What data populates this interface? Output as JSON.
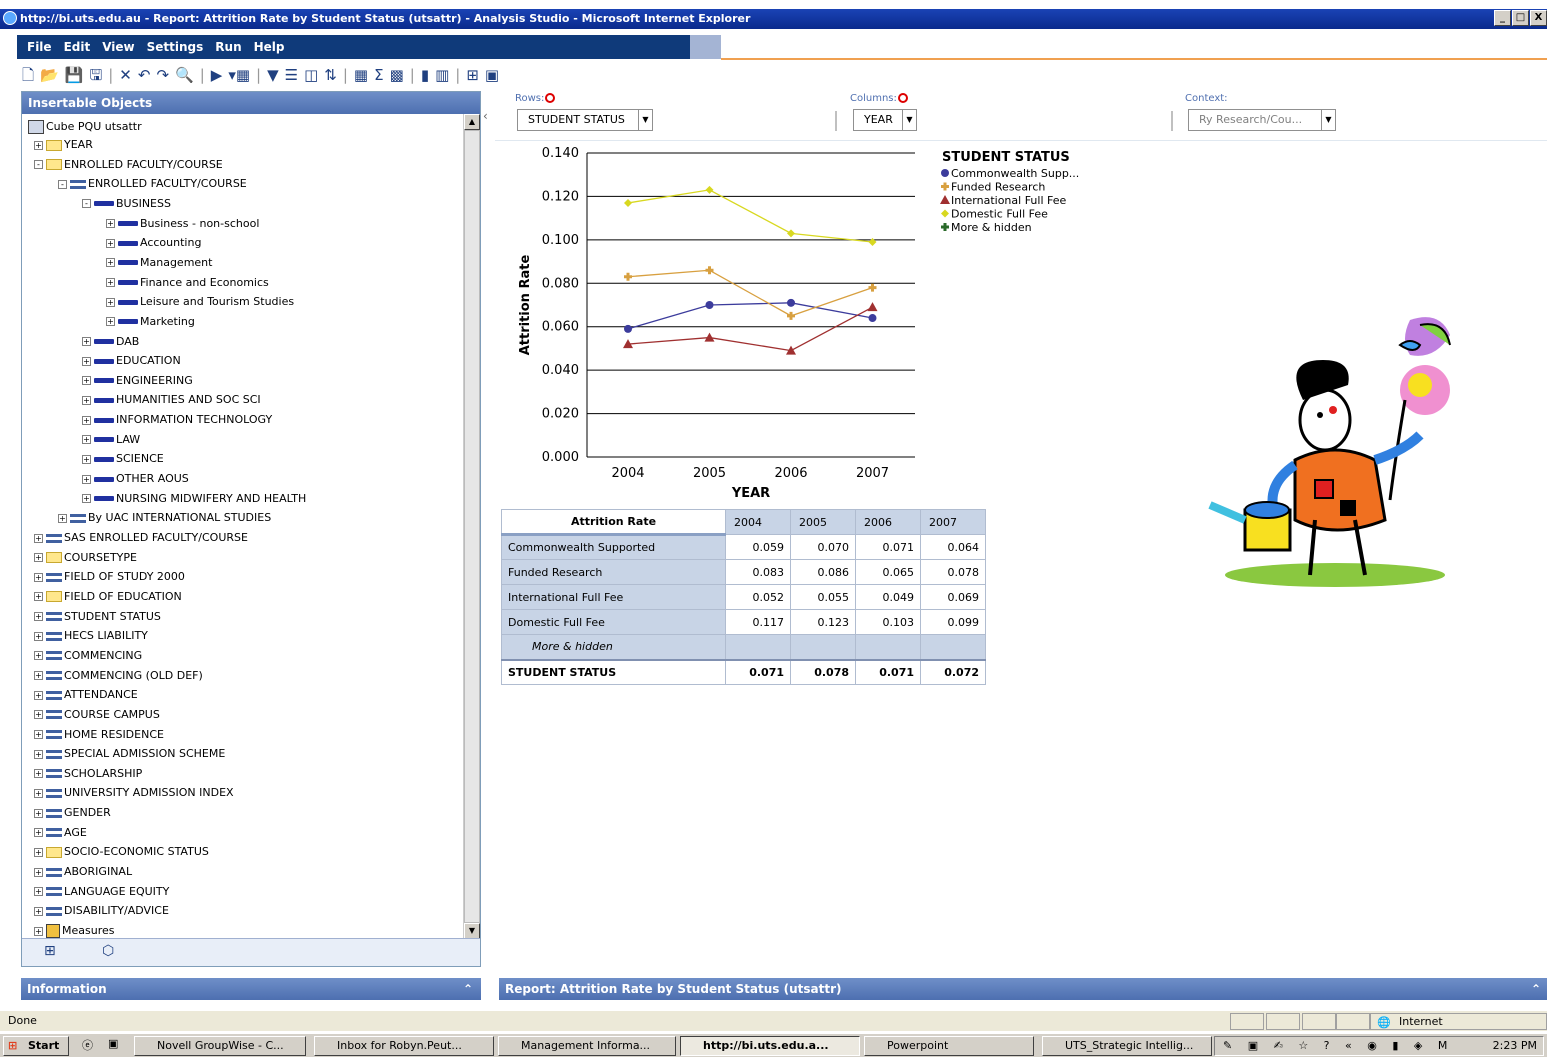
{
  "window": {
    "title": "http://bi.uts.edu.au - Report: Attrition Rate by Student Status (utsattr) - Analysis Studio - Microsoft Internet Explorer",
    "minimize": "_",
    "maximize": "□",
    "close": "X"
  },
  "menu": [
    "File",
    "Edit",
    "View",
    "Settings",
    "Run",
    "Help"
  ],
  "toolbar_icons": [
    "new-icon",
    "open-icon",
    "save-icon",
    "save-as-icon",
    "delete-icon",
    "undo-icon",
    "redo-icon",
    "find-icon",
    "run-icon",
    "group-icon",
    "filter-icon",
    "suppress-icon",
    "top-bottom-icon",
    "sort-icon",
    "calculate-icon",
    "sum-icon",
    "excel-icon",
    "chart-icon",
    "display-icon",
    "insert-icon",
    "properties-icon"
  ],
  "insertable_objects": {
    "title": "Insertable Objects",
    "cube": "Cube PQU utsattr",
    "nodes": [
      {
        "label": "YEAR",
        "icon": "folder",
        "level": 0,
        "exp": "+"
      },
      {
        "label": "ENROLLED FACULTY/COURSE",
        "icon": "folder",
        "level": 0,
        "exp": "-"
      },
      {
        "label": "ENROLLED FACULTY/COURSE",
        "icon": "dim",
        "level": 1,
        "exp": "-"
      },
      {
        "label": "BUSINESS",
        "icon": "bar",
        "level": 2,
        "exp": "-"
      },
      {
        "label": "Business - non-school",
        "icon": "bar",
        "level": 3,
        "exp": "+"
      },
      {
        "label": "Accounting",
        "icon": "bar",
        "level": 3,
        "exp": "+"
      },
      {
        "label": "Management",
        "icon": "bar",
        "level": 3,
        "exp": "+"
      },
      {
        "label": "Finance and Economics",
        "icon": "bar",
        "level": 3,
        "exp": "+"
      },
      {
        "label": "Leisure and Tourism Studies",
        "icon": "bar",
        "level": 3,
        "exp": "+"
      },
      {
        "label": "Marketing",
        "icon": "bar",
        "level": 3,
        "exp": "+"
      },
      {
        "label": "DAB",
        "icon": "bar",
        "level": 2,
        "exp": "+"
      },
      {
        "label": "EDUCATION",
        "icon": "bar",
        "level": 2,
        "exp": "+"
      },
      {
        "label": "ENGINEERING",
        "icon": "bar",
        "level": 2,
        "exp": "+"
      },
      {
        "label": "HUMANITIES AND SOC SCI",
        "icon": "bar",
        "level": 2,
        "exp": "+"
      },
      {
        "label": "INFORMATION TECHNOLOGY",
        "icon": "bar",
        "level": 2,
        "exp": "+"
      },
      {
        "label": "LAW",
        "icon": "bar",
        "level": 2,
        "exp": "+"
      },
      {
        "label": "SCIENCE",
        "icon": "bar",
        "level": 2,
        "exp": "+"
      },
      {
        "label": "OTHER AOUS",
        "icon": "bar",
        "level": 2,
        "exp": "+"
      },
      {
        "label": "NURSING MIDWIFERY AND HEALTH",
        "icon": "bar",
        "level": 2,
        "exp": "+"
      },
      {
        "label": "By UAC INTERNATIONAL STUDIES",
        "icon": "dim",
        "level": 1,
        "exp": "+"
      },
      {
        "label": "SAS ENROLLED FACULTY/COURSE",
        "icon": "dim",
        "level": 0,
        "exp": "+"
      },
      {
        "label": "COURSETYPE",
        "icon": "folder",
        "level": 0,
        "exp": "+"
      },
      {
        "label": "FIELD OF STUDY 2000",
        "icon": "dim",
        "level": 0,
        "exp": "+"
      },
      {
        "label": "FIELD OF EDUCATION",
        "icon": "folder",
        "level": 0,
        "exp": "+"
      },
      {
        "label": "STUDENT STATUS",
        "icon": "dim",
        "level": 0,
        "exp": "+"
      },
      {
        "label": "HECS LIABILITY",
        "icon": "dim",
        "level": 0,
        "exp": "+"
      },
      {
        "label": "COMMENCING",
        "icon": "dim",
        "level": 0,
        "exp": "+"
      },
      {
        "label": "COMMENCING (OLD DEF)",
        "icon": "dim",
        "level": 0,
        "exp": "+"
      },
      {
        "label": "ATTENDANCE",
        "icon": "dim",
        "level": 0,
        "exp": "+"
      },
      {
        "label": "COURSE CAMPUS",
        "icon": "dim",
        "level": 0,
        "exp": "+"
      },
      {
        "label": "HOME RESIDENCE",
        "icon": "dim",
        "level": 0,
        "exp": "+"
      },
      {
        "label": "SPECIAL ADMISSION SCHEME",
        "icon": "dim",
        "level": 0,
        "exp": "+"
      },
      {
        "label": "SCHOLARSHIP",
        "icon": "dim",
        "level": 0,
        "exp": "+"
      },
      {
        "label": "UNIVERSITY ADMISSION INDEX",
        "icon": "dim",
        "level": 0,
        "exp": "+"
      },
      {
        "label": "GENDER",
        "icon": "dim",
        "level": 0,
        "exp": "+"
      },
      {
        "label": "AGE",
        "icon": "dim",
        "level": 0,
        "exp": "+"
      },
      {
        "label": "SOCIO-ECONOMIC STATUS",
        "icon": "folder",
        "level": 0,
        "exp": "+"
      },
      {
        "label": "ABORIGINAL",
        "icon": "dim",
        "level": 0,
        "exp": "+"
      },
      {
        "label": "LANGUAGE EQUITY",
        "icon": "dim",
        "level": 0,
        "exp": "+"
      },
      {
        "label": "DISABILITY/ADVICE",
        "icon": "dim",
        "level": 0,
        "exp": "+"
      },
      {
        "label": "Measures",
        "icon": "meas",
        "level": 0,
        "exp": "+"
      }
    ]
  },
  "information": {
    "title": "Information"
  },
  "drop_zones": {
    "rows_label": "Rows:",
    "rows_value": "STUDENT STATUS",
    "columns_label": "Columns:",
    "columns_value": "YEAR",
    "context_label": "Context:",
    "context_value": "Ry Research/Cou..."
  },
  "chart_data": {
    "type": "line",
    "x": [
      "2004",
      "2005",
      "2006",
      "2007"
    ],
    "xlabel": "YEAR",
    "ylabel": "Attrition Rate",
    "ylim": [
      0,
      0.14
    ],
    "yticks": [
      "0.000",
      "0.020",
      "0.040",
      "0.060",
      "0.080",
      "0.100",
      "0.120",
      "0.140"
    ],
    "legend_title": "STUDENT STATUS",
    "legend_placement": "right",
    "series": [
      {
        "name": "Commonwealth Supp...",
        "values": [
          0.059,
          0.07,
          0.071,
          0.064
        ],
        "color": "#3c3c9c",
        "marker": "circle"
      },
      {
        "name": "Funded Research",
        "values": [
          0.083,
          0.086,
          0.065,
          0.078
        ],
        "color": "#d8a040",
        "marker": "plus"
      },
      {
        "name": "International Full Fee",
        "values": [
          0.052,
          0.055,
          0.049,
          0.069
        ],
        "color": "#a03030",
        "marker": "triangle"
      },
      {
        "name": "Domestic Full Fee",
        "values": [
          0.117,
          0.123,
          0.103,
          0.099
        ],
        "color": "#d8d820",
        "marker": "diamond"
      },
      {
        "name": "More & hidden",
        "values": [],
        "color": "#2a6a2a",
        "marker": "plus"
      }
    ]
  },
  "table": {
    "corner": "Attrition Rate",
    "columns": [
      "2004",
      "2005",
      "2006",
      "2007"
    ],
    "rows": [
      {
        "label": "Commonwealth Supported",
        "values": [
          "0.059",
          "0.070",
          "0.071",
          "0.064"
        ]
      },
      {
        "label": "Funded Research",
        "values": [
          "0.083",
          "0.086",
          "0.065",
          "0.078"
        ]
      },
      {
        "label": "International Full Fee",
        "values": [
          "0.052",
          "0.055",
          "0.049",
          "0.069"
        ]
      },
      {
        "label": "Domestic Full Fee",
        "values": [
          "0.117",
          "0.123",
          "0.103",
          "0.099"
        ]
      },
      {
        "label": "More & hidden",
        "values": [
          "",
          "",
          "",
          ""
        ]
      }
    ],
    "total": {
      "label": "STUDENT STATUS",
      "values": [
        "0.071",
        "0.078",
        "0.071",
        "0.072"
      ]
    }
  },
  "report_bar": {
    "title": "Report: Attrition Rate by Student Status (utsattr)"
  },
  "status": {
    "text": "Done",
    "zone": "Internet"
  },
  "taskbar": {
    "start": "Start",
    "items": [
      {
        "label": "Novell GroupWise - C...",
        "active": false
      },
      {
        "label": "Inbox for Robyn.Peut...",
        "active": false
      },
      {
        "label": "Management Informa...",
        "active": false
      },
      {
        "label": "http://bi.uts.edu.a...",
        "active": true
      },
      {
        "label": "Powerpoint",
        "active": false
      },
      {
        "label": "UTS_Strategic Intellig...",
        "active": false
      }
    ],
    "clock": "2:23 PM"
  }
}
